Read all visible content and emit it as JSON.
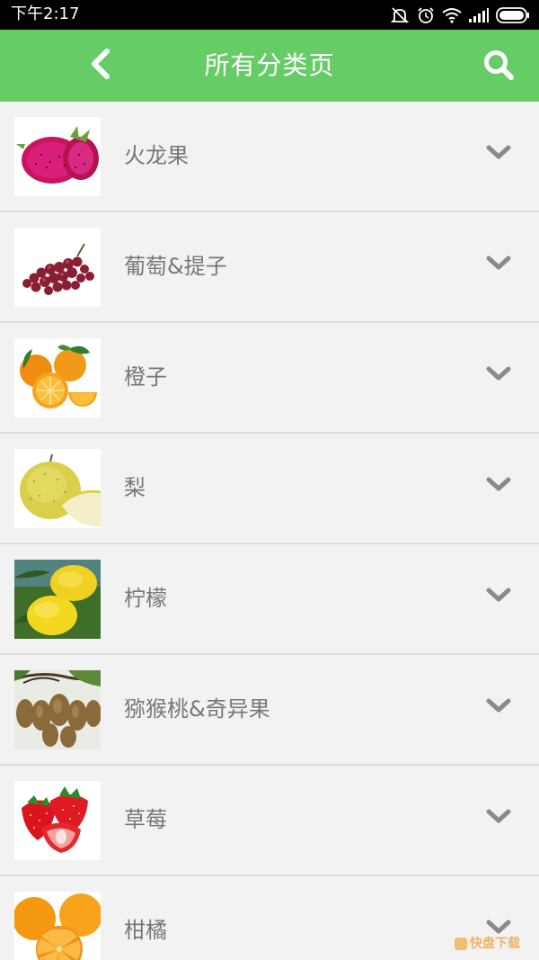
{
  "status_bar": {
    "time": "下午2:17",
    "icons": [
      "mute-icon",
      "alarm-icon",
      "wifi-icon",
      "signal-icon",
      "battery-icon"
    ]
  },
  "header": {
    "title": "所有分类页",
    "back_icon": "chevron-left-icon",
    "search_icon": "search-icon",
    "background": "#66cc66"
  },
  "categories": [
    {
      "label": "火龙果",
      "image": "dragon-fruit"
    },
    {
      "label": "葡萄&提子",
      "image": "grapes"
    },
    {
      "label": "橙子",
      "image": "oranges"
    },
    {
      "label": "梨",
      "image": "pear"
    },
    {
      "label": "柠檬",
      "image": "lemons"
    },
    {
      "label": "猕猴桃&奇异果",
      "image": "kiwi"
    },
    {
      "label": "草莓",
      "image": "strawberries"
    },
    {
      "label": "柑橘",
      "image": "tangerines"
    }
  ],
  "colors": {
    "label_text": "#777777",
    "chevron": "#8a8a8a",
    "divider": "#dcdcdc",
    "background": "#f2f2f2"
  }
}
